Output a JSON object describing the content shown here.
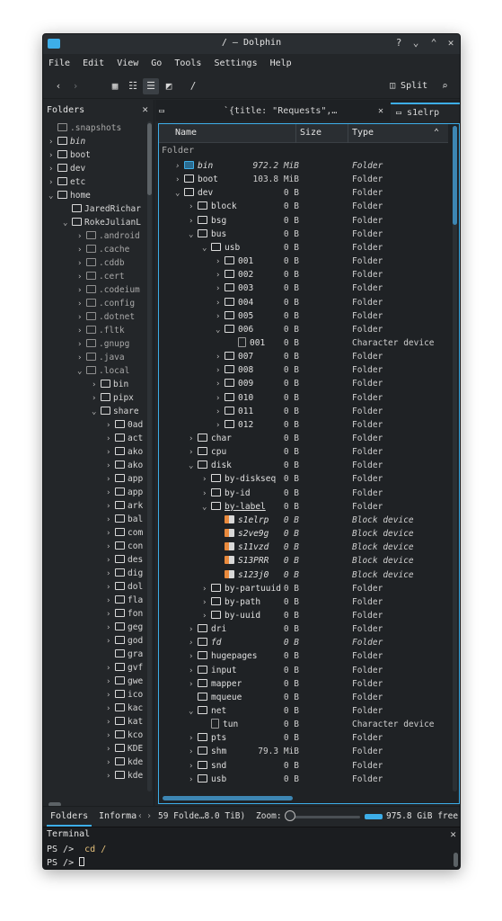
{
  "window": {
    "title": "/ — Dolphin"
  },
  "menu": [
    "File",
    "Edit",
    "View",
    "Go",
    "Tools",
    "Settings",
    "Help"
  ],
  "toolbar": {
    "split_label": "Split",
    "path_label": "/"
  },
  "folders_panel": {
    "title": "Folders",
    "items": [
      {
        "label": ".snapshots",
        "depth": 0,
        "chev": "",
        "dim": true
      },
      {
        "label": "bin",
        "depth": 0,
        "chev": ">",
        "dim": false,
        "italic": true
      },
      {
        "label": "boot",
        "depth": 0,
        "chev": ">",
        "dim": false
      },
      {
        "label": "dev",
        "depth": 0,
        "chev": ">",
        "dim": false
      },
      {
        "label": "etc",
        "depth": 0,
        "chev": ">",
        "dim": false
      },
      {
        "label": "home",
        "depth": 0,
        "chev": "v",
        "dim": false
      },
      {
        "label": "JaredRichar",
        "depth": 1,
        "chev": "",
        "dim": false
      },
      {
        "label": "RokeJulianL",
        "depth": 1,
        "chev": "v",
        "dim": false
      },
      {
        "label": ".android",
        "depth": 2,
        "chev": ">",
        "dim": true
      },
      {
        "label": ".cache",
        "depth": 2,
        "chev": ">",
        "dim": true
      },
      {
        "label": ".cddb",
        "depth": 2,
        "chev": ">",
        "dim": true
      },
      {
        "label": ".cert",
        "depth": 2,
        "chev": ">",
        "dim": true
      },
      {
        "label": ".codeium",
        "depth": 2,
        "chev": ">",
        "dim": true
      },
      {
        "label": ".config",
        "depth": 2,
        "chev": ">",
        "dim": true
      },
      {
        "label": ".dotnet",
        "depth": 2,
        "chev": ">",
        "dim": true
      },
      {
        "label": ".fltk",
        "depth": 2,
        "chev": ">",
        "dim": true
      },
      {
        "label": ".gnupg",
        "depth": 2,
        "chev": ">",
        "dim": true
      },
      {
        "label": ".java",
        "depth": 2,
        "chev": ">",
        "dim": true
      },
      {
        "label": ".local",
        "depth": 2,
        "chev": "v",
        "dim": true
      },
      {
        "label": "bin",
        "depth": 3,
        "chev": ">",
        "dim": false
      },
      {
        "label": "pipx",
        "depth": 3,
        "chev": ">",
        "dim": false
      },
      {
        "label": "share",
        "depth": 3,
        "chev": "v",
        "dim": false
      },
      {
        "label": "0ad",
        "depth": 4,
        "chev": ">",
        "dim": false
      },
      {
        "label": "act",
        "depth": 4,
        "chev": ">",
        "dim": false
      },
      {
        "label": "ako",
        "depth": 4,
        "chev": ">",
        "dim": false
      },
      {
        "label": "ako",
        "depth": 4,
        "chev": ">",
        "dim": false
      },
      {
        "label": "app",
        "depth": 4,
        "chev": ">",
        "dim": false
      },
      {
        "label": "app",
        "depth": 4,
        "chev": ">",
        "dim": false
      },
      {
        "label": "ark",
        "depth": 4,
        "chev": ">",
        "dim": false
      },
      {
        "label": "bal",
        "depth": 4,
        "chev": ">",
        "dim": false
      },
      {
        "label": "com",
        "depth": 4,
        "chev": ">",
        "dim": false
      },
      {
        "label": "con",
        "depth": 4,
        "chev": ">",
        "dim": false
      },
      {
        "label": "des",
        "depth": 4,
        "chev": ">",
        "dim": false
      },
      {
        "label": "dig",
        "depth": 4,
        "chev": ">",
        "dim": false
      },
      {
        "label": "dol",
        "depth": 4,
        "chev": ">",
        "dim": false
      },
      {
        "label": "fla",
        "depth": 4,
        "chev": ">",
        "dim": false
      },
      {
        "label": "fon",
        "depth": 4,
        "chev": ">",
        "dim": false
      },
      {
        "label": "geg",
        "depth": 4,
        "chev": ">",
        "dim": false
      },
      {
        "label": "god",
        "depth": 4,
        "chev": ">",
        "dim": false
      },
      {
        "label": "gra",
        "depth": 4,
        "chev": "",
        "dim": false
      },
      {
        "label": "gvf",
        "depth": 4,
        "chev": ">",
        "dim": false
      },
      {
        "label": "gwe",
        "depth": 4,
        "chev": ">",
        "dim": false
      },
      {
        "label": "ico",
        "depth": 4,
        "chev": ">",
        "dim": false
      },
      {
        "label": "kac",
        "depth": 4,
        "chev": ">",
        "dim": false
      },
      {
        "label": "kat",
        "depth": 4,
        "chev": ">",
        "dim": false
      },
      {
        "label": "kco",
        "depth": 4,
        "chev": ">",
        "dim": false
      },
      {
        "label": "KDE",
        "depth": 4,
        "chev": ">",
        "dim": false
      },
      {
        "label": "kde",
        "depth": 4,
        "chev": ">",
        "dim": false
      },
      {
        "label": "kde",
        "depth": 4,
        "chev": ">",
        "dim": false
      }
    ]
  },
  "tabs": [
    {
      "label": "`{title: \"Requests\",…",
      "active": false
    },
    {
      "label": "s1elrp",
      "active": true
    }
  ],
  "columns": {
    "name": "Name",
    "size": "Size",
    "type": "Type"
  },
  "group_label": "Folder",
  "files": [
    {
      "name": "bin",
      "depth": 0,
      "chev": ">",
      "size": "972.2 MiB",
      "type": "Folder",
      "icon": "bin",
      "italic": true
    },
    {
      "name": "boot",
      "depth": 0,
      "chev": ">",
      "size": "103.8 MiB",
      "type": "Folder",
      "icon": "folder"
    },
    {
      "name": "dev",
      "depth": 0,
      "chev": "v",
      "size": "0 B",
      "type": "Folder",
      "icon": "folder"
    },
    {
      "name": "block",
      "depth": 1,
      "chev": ">",
      "size": "0 B",
      "type": "Folder",
      "icon": "folder"
    },
    {
      "name": "bsg",
      "depth": 1,
      "chev": ">",
      "size": "0 B",
      "type": "Folder",
      "icon": "folder"
    },
    {
      "name": "bus",
      "depth": 1,
      "chev": "v",
      "size": "0 B",
      "type": "Folder",
      "icon": "folder"
    },
    {
      "name": "usb",
      "depth": 2,
      "chev": "v",
      "size": "0 B",
      "type": "Folder",
      "icon": "folder"
    },
    {
      "name": "001",
      "depth": 3,
      "chev": ">",
      "size": "0 B",
      "type": "Folder",
      "icon": "folder"
    },
    {
      "name": "002",
      "depth": 3,
      "chev": ">",
      "size": "0 B",
      "type": "Folder",
      "icon": "folder"
    },
    {
      "name": "003",
      "depth": 3,
      "chev": ">",
      "size": "0 B",
      "type": "Folder",
      "icon": "folder"
    },
    {
      "name": "004",
      "depth": 3,
      "chev": ">",
      "size": "0 B",
      "type": "Folder",
      "icon": "folder"
    },
    {
      "name": "005",
      "depth": 3,
      "chev": ">",
      "size": "0 B",
      "type": "Folder",
      "icon": "folder"
    },
    {
      "name": "006",
      "depth": 3,
      "chev": "v",
      "size": "0 B",
      "type": "Folder",
      "icon": "folder"
    },
    {
      "name": "001",
      "depth": 4,
      "chev": "",
      "size": "0 B",
      "type": "Character device",
      "icon": "file"
    },
    {
      "name": "007",
      "depth": 3,
      "chev": ">",
      "size": "0 B",
      "type": "Folder",
      "icon": "folder"
    },
    {
      "name": "008",
      "depth": 3,
      "chev": ">",
      "size": "0 B",
      "type": "Folder",
      "icon": "folder"
    },
    {
      "name": "009",
      "depth": 3,
      "chev": ">",
      "size": "0 B",
      "type": "Folder",
      "icon": "folder"
    },
    {
      "name": "010",
      "depth": 3,
      "chev": ">",
      "size": "0 B",
      "type": "Folder",
      "icon": "folder"
    },
    {
      "name": "011",
      "depth": 3,
      "chev": ">",
      "size": "0 B",
      "type": "Folder",
      "icon": "folder"
    },
    {
      "name": "012",
      "depth": 3,
      "chev": ">",
      "size": "0 B",
      "type": "Folder",
      "icon": "folder"
    },
    {
      "name": "char",
      "depth": 1,
      "chev": ">",
      "size": "0 B",
      "type": "Folder",
      "icon": "folder"
    },
    {
      "name": "cpu",
      "depth": 1,
      "chev": ">",
      "size": "0 B",
      "type": "Folder",
      "icon": "folder"
    },
    {
      "name": "disk",
      "depth": 1,
      "chev": "v",
      "size": "0 B",
      "type": "Folder",
      "icon": "folder"
    },
    {
      "name": "by-diskseq",
      "depth": 2,
      "chev": ">",
      "size": "0 B",
      "type": "Folder",
      "icon": "folder"
    },
    {
      "name": "by-id",
      "depth": 2,
      "chev": ">",
      "size": "0 B",
      "type": "Folder",
      "icon": "folder"
    },
    {
      "name": "by-label",
      "depth": 2,
      "chev": "v",
      "size": "0 B",
      "type": "Folder",
      "icon": "folder",
      "underline": true
    },
    {
      "name": "s1elrp",
      "depth": 3,
      "chev": "",
      "size": "0 B",
      "type": "Block device",
      "icon": "block",
      "italic": true
    },
    {
      "name": "s2ve9g",
      "depth": 3,
      "chev": "",
      "size": "0 B",
      "type": "Block device",
      "icon": "block",
      "italic": true
    },
    {
      "name": "s11vzd",
      "depth": 3,
      "chev": "",
      "size": "0 B",
      "type": "Block device",
      "icon": "block",
      "italic": true
    },
    {
      "name": "S13PRR",
      "depth": 3,
      "chev": "",
      "size": "0 B",
      "type": "Block device",
      "icon": "block",
      "italic": true
    },
    {
      "name": "s123j0",
      "depth": 3,
      "chev": "",
      "size": "0 B",
      "type": "Block device",
      "icon": "block",
      "italic": true
    },
    {
      "name": "by-partuuid",
      "depth": 2,
      "chev": ">",
      "size": "0 B",
      "type": "Folder",
      "icon": "folder"
    },
    {
      "name": "by-path",
      "depth": 2,
      "chev": ">",
      "size": "0 B",
      "type": "Folder",
      "icon": "folder"
    },
    {
      "name": "by-uuid",
      "depth": 2,
      "chev": ">",
      "size": "0 B",
      "type": "Folder",
      "icon": "folder"
    },
    {
      "name": "dri",
      "depth": 1,
      "chev": ">",
      "size": "0 B",
      "type": "Folder",
      "icon": "folder"
    },
    {
      "name": "fd",
      "depth": 1,
      "chev": ">",
      "size": "0 B",
      "type": "Folder",
      "icon": "folder",
      "italic": true
    },
    {
      "name": "hugepages",
      "depth": 1,
      "chev": ">",
      "size": "0 B",
      "type": "Folder",
      "icon": "folder"
    },
    {
      "name": "input",
      "depth": 1,
      "chev": ">",
      "size": "0 B",
      "type": "Folder",
      "icon": "folder"
    },
    {
      "name": "mapper",
      "depth": 1,
      "chev": ">",
      "size": "0 B",
      "type": "Folder",
      "icon": "folder"
    },
    {
      "name": "mqueue",
      "depth": 1,
      "chev": "",
      "size": "0 B",
      "type": "Folder",
      "icon": "folder"
    },
    {
      "name": "net",
      "depth": 1,
      "chev": "v",
      "size": "0 B",
      "type": "Folder",
      "icon": "folder"
    },
    {
      "name": "tun",
      "depth": 2,
      "chev": "",
      "size": "0 B",
      "type": "Character device",
      "icon": "file"
    },
    {
      "name": "pts",
      "depth": 1,
      "chev": ">",
      "size": "0 B",
      "type": "Folder",
      "icon": "folder"
    },
    {
      "name": "shm",
      "depth": 1,
      "chev": ">",
      "size": "79.3 MiB",
      "type": "Folder",
      "icon": "folder"
    },
    {
      "name": "snd",
      "depth": 1,
      "chev": ">",
      "size": "0 B",
      "type": "Folder",
      "icon": "folder"
    },
    {
      "name": "usb",
      "depth": 1,
      "chev": ">",
      "size": "0 B",
      "type": "Folder",
      "icon": "folder"
    }
  ],
  "statusbar": {
    "tab_folders": "Folders",
    "tab_info": "Informa",
    "status": "59 Folde…8.0 TiB)",
    "zoom_label": "Zoom:",
    "free": "975.8 GiB free"
  },
  "terminal": {
    "title": "Terminal",
    "line1_prompt": "PS />",
    "line1_cmd": "cd /",
    "line2_prompt": "PS />"
  },
  "colors": {
    "accent": "#3daee9",
    "block_icon": "#e98a3d"
  }
}
